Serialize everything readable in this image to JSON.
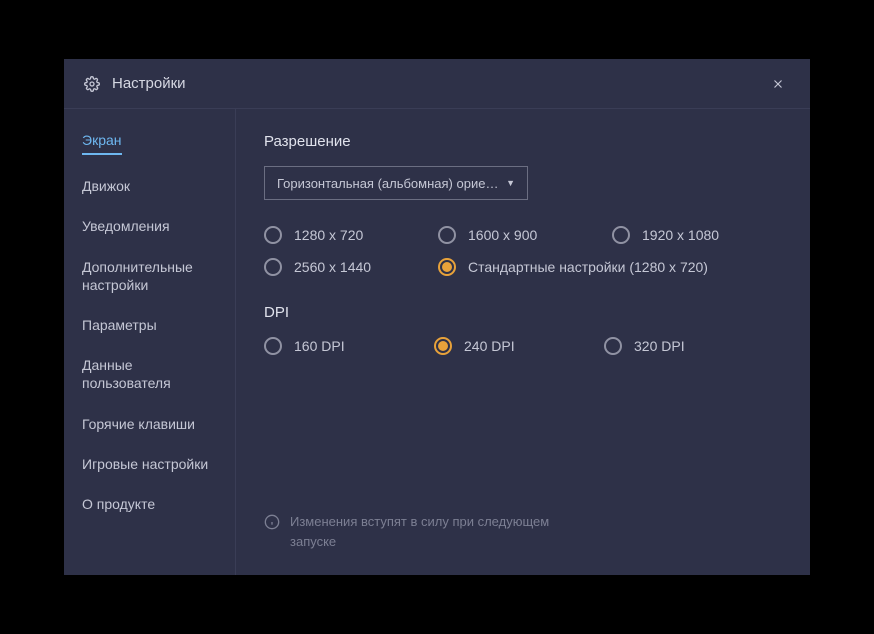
{
  "header": {
    "title": "Настройки"
  },
  "sidebar": {
    "items": [
      {
        "label": "Экран",
        "active": true
      },
      {
        "label": "Движок",
        "active": false
      },
      {
        "label": "Уведомления",
        "active": false
      },
      {
        "label": "Дополнительные настройки",
        "active": false
      },
      {
        "label": "Параметры",
        "active": false
      },
      {
        "label": "Данные пользователя",
        "active": false
      },
      {
        "label": "Горячие клавиши",
        "active": false
      },
      {
        "label": "Игровые настройки",
        "active": false
      },
      {
        "label": "О продукте",
        "active": false
      }
    ]
  },
  "content": {
    "resolution": {
      "title": "Разрешение",
      "dropdown": "Горизонтальная (альбомная) ориентация",
      "options": [
        {
          "label": "1280 x 720",
          "selected": false
        },
        {
          "label": "1600 x 900",
          "selected": false
        },
        {
          "label": "1920 x 1080",
          "selected": false
        },
        {
          "label": "2560 x 1440",
          "selected": false
        },
        {
          "label": "Стандартные настройки (1280 x 720)",
          "selected": true
        }
      ]
    },
    "dpi": {
      "title": "DPI",
      "options": [
        {
          "label": "160 DPI",
          "selected": false
        },
        {
          "label": "240 DPI",
          "selected": true
        },
        {
          "label": "320 DPI",
          "selected": false
        }
      ]
    },
    "notice": "Изменения вступят в силу при следующем запуске"
  },
  "colors": {
    "background": "#2e3148",
    "accent": "#6eb7f0",
    "selected": "#e8a23a",
    "text": "#c5c7d5",
    "muted": "#7c7f93"
  }
}
